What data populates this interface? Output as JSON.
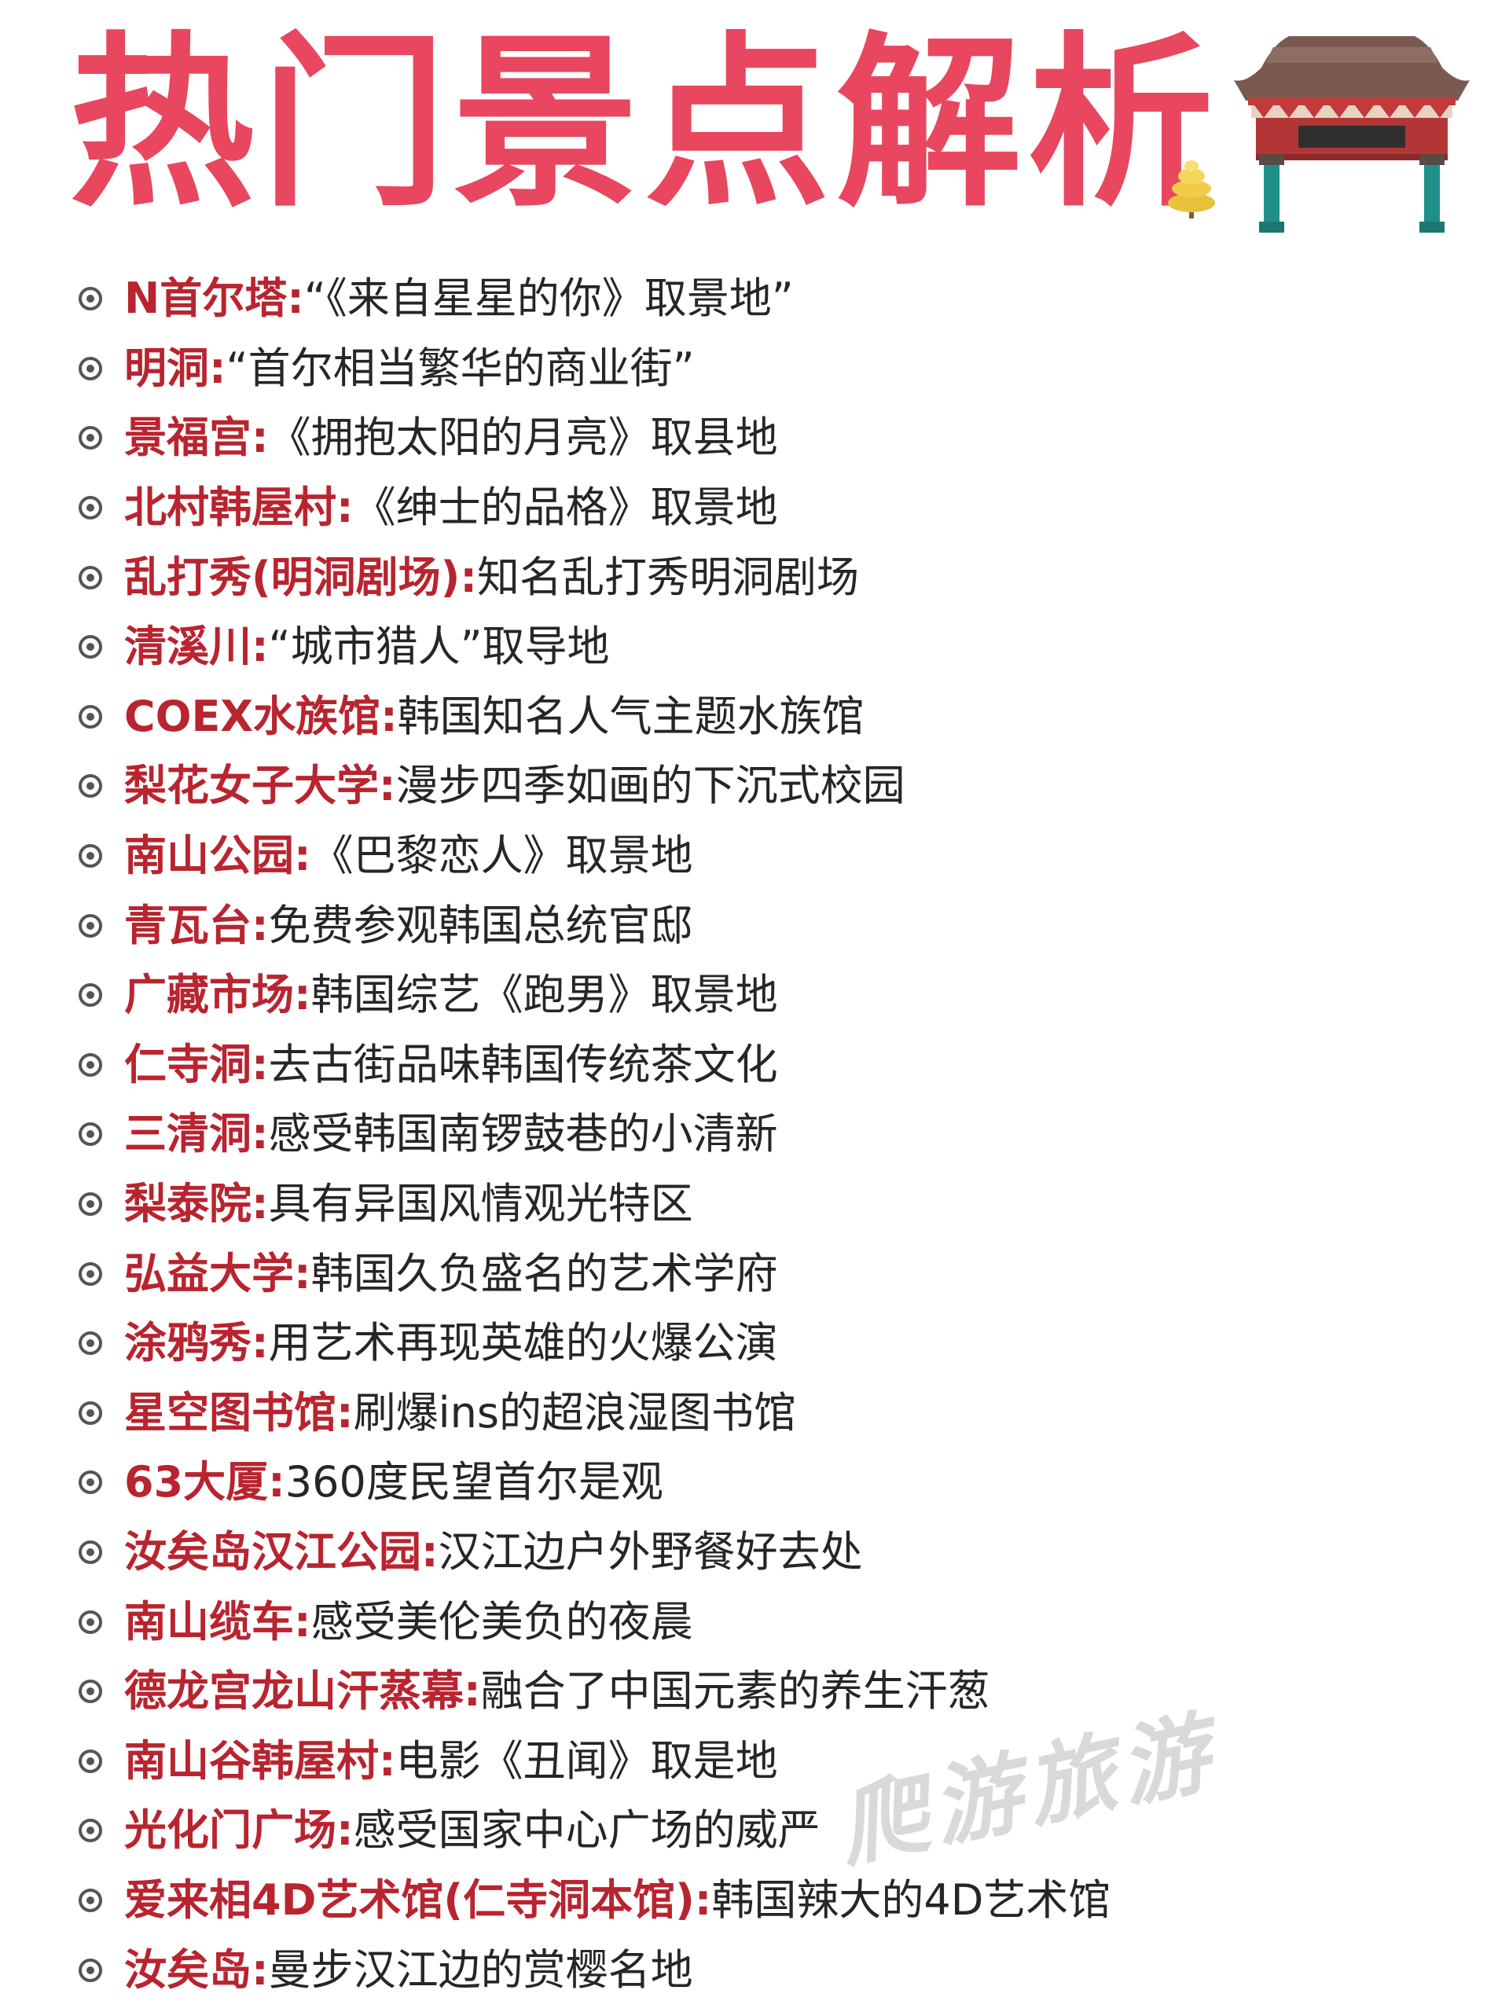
{
  "title": "热门景点解析",
  "colors": {
    "title": "#e8475f",
    "spot_name": "#b8242f",
    "desc": "#262626",
    "bullet": "#555555"
  },
  "spots": [
    {
      "name": "N首尔塔",
      "sep": ":",
      "desc": "“《来自星星的你》取景地”"
    },
    {
      "name": "明洞",
      "sep": ":",
      "desc": "“首尔相当繁华的商业街”"
    },
    {
      "name": "景福宫",
      "sep": ":",
      "desc": "《拥抱太阳的月亮》取县地"
    },
    {
      "name": "北村韩屋村",
      "sep": ":",
      "desc": "《绅士的品格》取景地"
    },
    {
      "name": "乱打秀(明洞剧场)",
      "sep": ":",
      "desc": "知名乱打秀明洞剧场"
    },
    {
      "name": "清溪川",
      "sep": ":",
      "desc": "“城市猎人”取导地"
    },
    {
      "name": "COEX水族馆",
      "sep": ":",
      "desc": "韩国知名人气主题水族馆"
    },
    {
      "name": "梨花女子大学",
      "sep": ":",
      "desc": "漫步四季如画的下沉式校园"
    },
    {
      "name": "南山公园",
      "sep": ":",
      "desc": "《巴黎恋人》取景地"
    },
    {
      "name": "青瓦台",
      "sep": ":",
      "desc": "免费参观韩国总统官邸"
    },
    {
      "name": "广藏市场",
      "sep": ":",
      "desc": "韩国综艺《跑男》取景地"
    },
    {
      "name": "仁寺洞",
      "sep": ":",
      "desc": "去古街品味韩国传统茶文化"
    },
    {
      "name": "三清洞",
      "sep": ":",
      "desc": "感受韩国南锣鼓巷的小清新"
    },
    {
      "name": "梨泰院",
      "sep": ":",
      "desc": "具有异国风情观光特区"
    },
    {
      "name": "弘益大学",
      "sep": ":",
      "desc": "韩国久负盛名的艺术学府"
    },
    {
      "name": "涂鸦秀",
      "sep": ":",
      "desc": "用艺术再现英雄的火爆公演"
    },
    {
      "name": "星空图书馆",
      "sep": ":",
      "desc": "刷爆ins的超浪湿图书馆"
    },
    {
      "name": "63大厦",
      "sep": ":",
      "desc": "360度民望首尔是观"
    },
    {
      "name": "汝矣岛汉江公园",
      "sep": ":",
      "desc": "汉江边户外野餐好去处"
    },
    {
      "name": "南山缆车",
      "sep": ":",
      "desc": "感受美伦美负的夜晨"
    },
    {
      "name": "德龙宫龙山汗蒸幕",
      "sep": ":",
      "desc": "融合了中国元素的养生汗葱"
    },
    {
      "name": "南山谷韩屋村",
      "sep": ":",
      "desc": "电影《丑闻》取是地"
    },
    {
      "name": "光化门广场",
      "sep": ":",
      "desc": "感受国家中心广场的威严"
    },
    {
      "name": "爱来相4D艺术馆(仁寺洞本馆)",
      "sep": ":",
      "desc": "韩国辣大的4D艺术馆"
    },
    {
      "name": "汝矣岛",
      "sep": ":",
      "desc": "曼步汉江边的赏樱名地"
    }
  ],
  "watermark": "爬游旅游",
  "icons": {
    "tree": "tree-icon",
    "gate": "korean-gate-icon"
  }
}
